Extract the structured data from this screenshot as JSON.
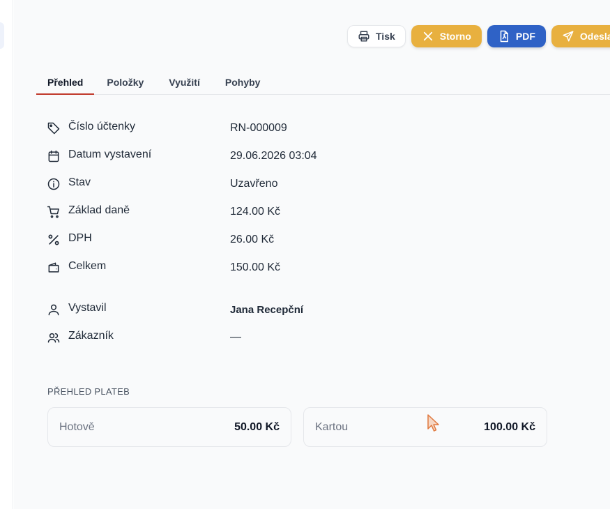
{
  "toolbar": {
    "print_label": "Tisk",
    "storno_label": "Storno",
    "pdf_label": "PDF",
    "send_label": "Odesla",
    "colors": {
      "storno": "#e8b03f",
      "pdf": "#2f62c6",
      "send": "#e8b03f"
    }
  },
  "tabs": [
    {
      "label": "Přehled",
      "active": true
    },
    {
      "label": "Položky",
      "active": false
    },
    {
      "label": "Využití",
      "active": false
    },
    {
      "label": "Pohyby",
      "active": false
    }
  ],
  "details": [
    {
      "icon": "tag-icon",
      "label": "Číslo účtenky",
      "value": "RN-000009"
    },
    {
      "icon": "calendar-icon",
      "label": "Datum vystavení",
      "value": "29.06.2026 03:04"
    },
    {
      "icon": "info-icon",
      "label": "Stav",
      "value": "Uzavřeno"
    },
    {
      "icon": "cart-icon",
      "label": "Základ daně",
      "value": "124.00 Kč"
    },
    {
      "icon": "percent-icon",
      "label": "DPH",
      "value": "26.00 Kč"
    },
    {
      "icon": "wallet-icon",
      "label": "Celkem",
      "value": "150.00 Kč"
    },
    {
      "icon": "user-icon",
      "label": "Vystavil",
      "value": "Jana Recepční"
    },
    {
      "icon": "users-icon",
      "label": "Zákazník",
      "value": "—"
    }
  ],
  "payments": {
    "title": "PŘEHLED PLATEB",
    "items": [
      {
        "label": "Hotově",
        "value": "50.00 Kč"
      },
      {
        "label": "Kartou",
        "value": "100.00 Kč"
      }
    ]
  },
  "accent_color": "#c0392b"
}
